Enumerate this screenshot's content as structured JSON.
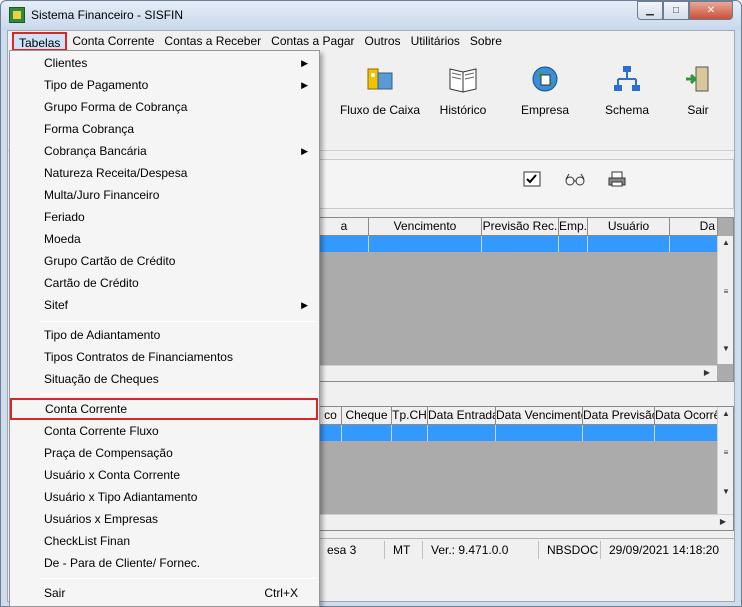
{
  "window": {
    "title": "Sistema Financeiro - SISFIN"
  },
  "menubar": {
    "items": [
      {
        "label": "Tabelas"
      },
      {
        "label": "Conta Corrente"
      },
      {
        "label": "Contas a Receber"
      },
      {
        "label": "Contas a Pagar"
      },
      {
        "label": "Outros"
      },
      {
        "label": "Utilitários"
      },
      {
        "label": "Sobre"
      }
    ]
  },
  "toolbar": {
    "fluxo": "Fluxo de Caixa",
    "historico": "Histórico",
    "empresa": "Empresa",
    "schema": "Schema",
    "sair": "Sair"
  },
  "grid1": {
    "headers": [
      "a",
      "Vencimento",
      "Previsão Rec.",
      "Emp.",
      "Usuário",
      "Da"
    ]
  },
  "grid2": {
    "headers": [
      "co",
      "Cheque",
      "Tp.CH",
      "Data Entrada",
      "Data Vencimento",
      "Data Previsão",
      "Data Ocorrê"
    ]
  },
  "statusbar": {
    "empresa": "esa 3",
    "uf": "MT",
    "version": "Ver.: 9.471.0.0",
    "user": "NBSDOC",
    "datetime": "29/09/2021 14:18:20"
  },
  "dropdown": {
    "items": [
      {
        "label": "Clientes",
        "submenu": true
      },
      {
        "label": "Tipo de Pagamento",
        "submenu": true
      },
      {
        "label": "Grupo Forma de Cobrança"
      },
      {
        "label": "Forma Cobrança"
      },
      {
        "label": "Cobrança Bancária",
        "submenu": true
      },
      {
        "label": "Natureza Receita/Despesa"
      },
      {
        "label": "Multa/Juro Financeiro"
      },
      {
        "label": "Feriado"
      },
      {
        "label": "Moeda"
      },
      {
        "label": "Grupo Cartão de Crédito"
      },
      {
        "label": "Cartão de Crédito"
      },
      {
        "label": "Sitef",
        "submenu": true
      },
      {
        "label": "Tipo de Adiantamento"
      },
      {
        "label": "Tipos Contratos de Financiamentos"
      },
      {
        "label": "Situação de Cheques"
      },
      {
        "label": "Conta Corrente"
      },
      {
        "label": "Conta Corrente Fluxo"
      },
      {
        "label": "Praça de Compensação"
      },
      {
        "label": "Usuário x Conta Corrente"
      },
      {
        "label": "Usuário x Tipo Adiantamento"
      },
      {
        "label": "Usuários x Empresas"
      },
      {
        "label": "CheckList Finan"
      },
      {
        "label": "De - Para de Cliente/ Fornec."
      },
      {
        "label": "Sair",
        "shortcut": "Ctrl+X"
      }
    ],
    "submenu_arrow": "▶"
  },
  "colors": {
    "highlight": "#d62828",
    "selection": "#3399ff"
  }
}
